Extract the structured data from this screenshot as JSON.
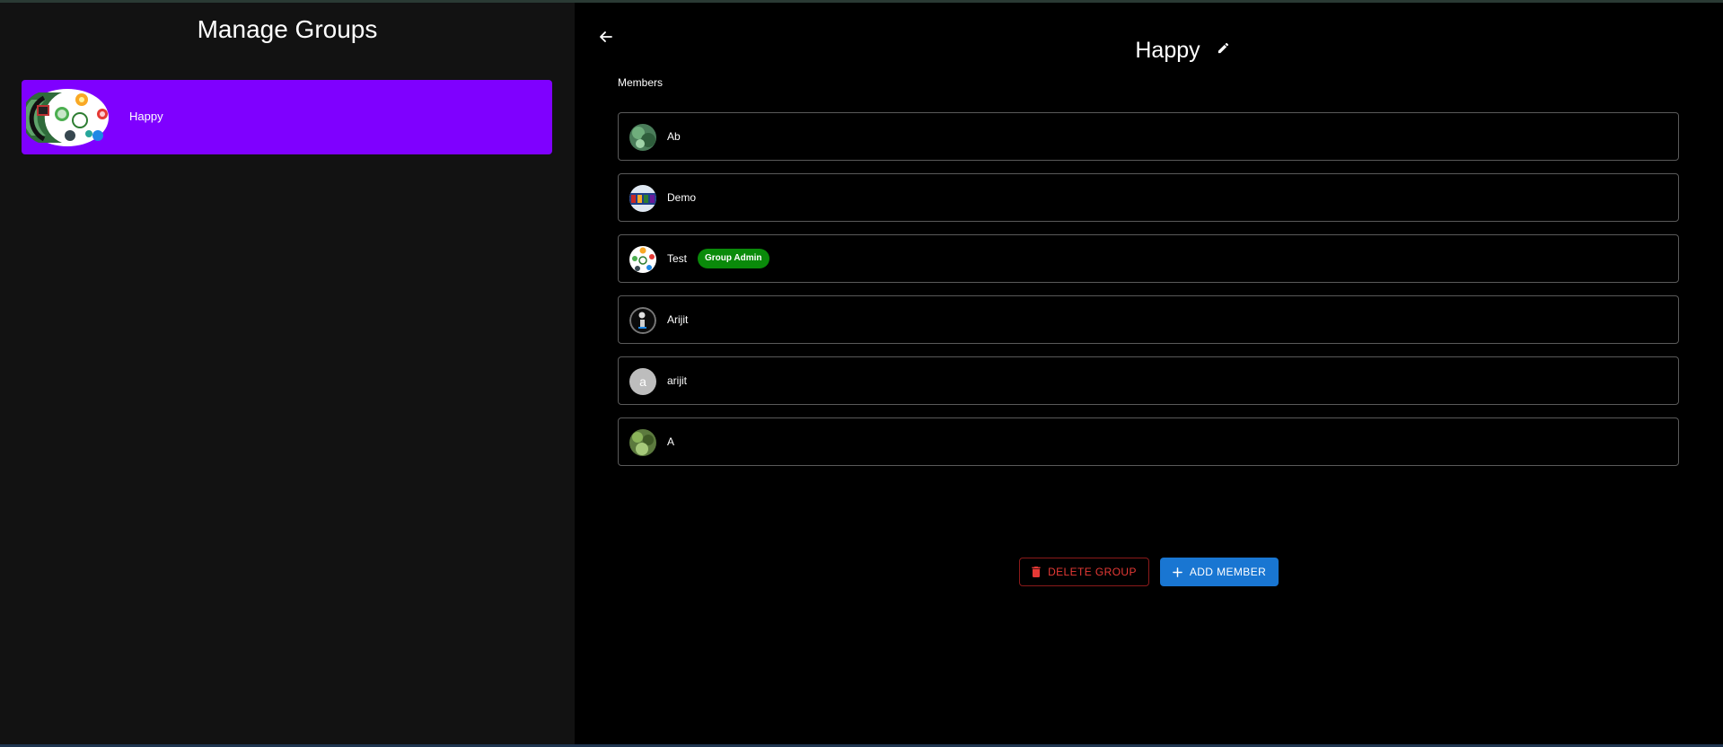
{
  "sidebar": {
    "title": "Manage Groups",
    "groups": [
      {
        "name": "Happy",
        "avatar_icon": "group-collage-avatar",
        "selected": true
      }
    ]
  },
  "header": {
    "back_icon": "arrow-left-icon",
    "group_name": "Happy",
    "edit_icon": "pencil-icon"
  },
  "members_label": "Members",
  "members": [
    {
      "name": "Ab",
      "avatar_icon": "photo-avatar"
    },
    {
      "name": "Demo",
      "avatar_icon": "photo-avatar"
    },
    {
      "name": "Test",
      "avatar_icon": "photo-avatar",
      "badge": "Group Admin"
    },
    {
      "name": "Arijit",
      "avatar_icon": "photo-avatar"
    },
    {
      "name": "arijit",
      "avatar_icon": "letter-avatar",
      "initial": "a"
    },
    {
      "name": "A",
      "avatar_icon": "photo-avatar"
    }
  ],
  "actions": {
    "delete_label": "DELETE GROUP",
    "delete_icon": "trash-icon",
    "add_label": "ADD MEMBER",
    "add_icon": "plus-icon"
  },
  "colors": {
    "sidebar_bg": "#121212",
    "selected_group": "#7f00ff",
    "admin_badge": "#0a8a0a",
    "delete": "#e53935",
    "primary": "#1976d2"
  }
}
